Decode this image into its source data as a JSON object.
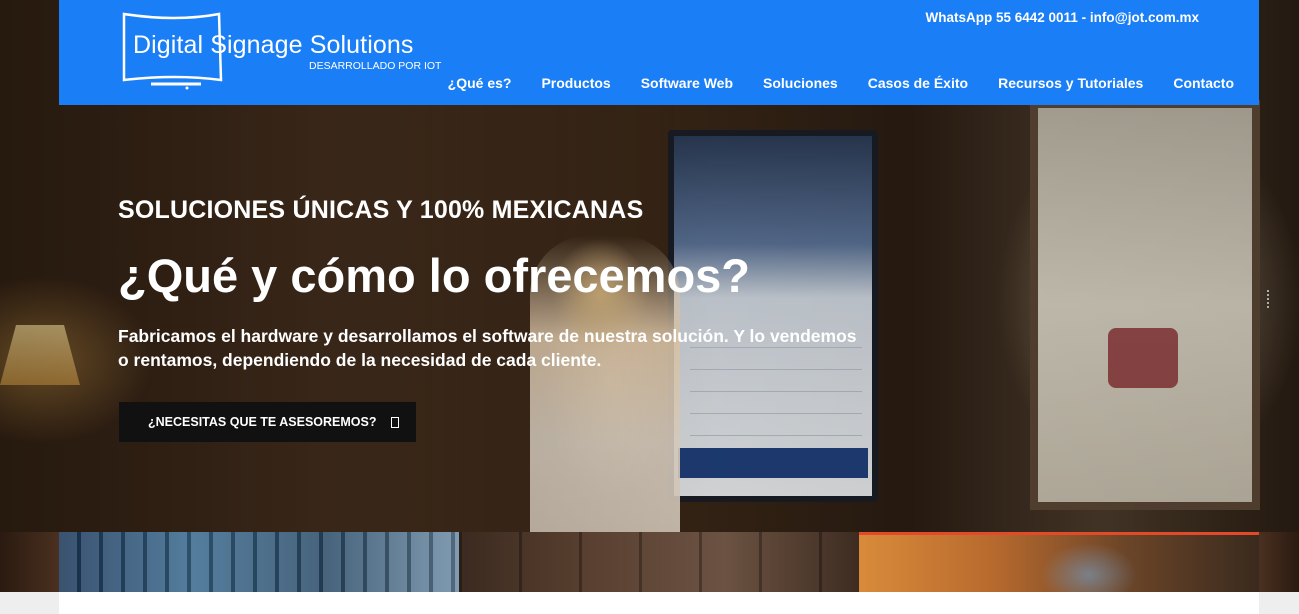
{
  "header": {
    "logo": {
      "title": "Digital Signage Solutions",
      "subtitle": "DESARROLLADO POR IOT"
    },
    "contact": "WhatsApp 55 6442 0011 - info@jot.com.mx",
    "nav": [
      {
        "label": "¿Qué es?"
      },
      {
        "label": "Productos"
      },
      {
        "label": "Software Web"
      },
      {
        "label": "Soluciones"
      },
      {
        "label": "Casos de Éxito"
      },
      {
        "label": "Recursos y Tutoriales"
      },
      {
        "label": "Contacto"
      }
    ]
  },
  "hero": {
    "kicker": "SOLUCIONES ÚNICAS Y 100% MEXICANAS",
    "headline": "¿Qué y cómo lo ofrecemos?",
    "description": "Fabricamos el hardware y desarrollamos el software de nuestra solución. Y lo vendemos o rentamos, dependiendo de la necesidad de cada cliente.",
    "cta_label": "¿NECESITAS QUE TE ASESOREMOS?",
    "cta_icon": "external-link-icon"
  },
  "colors": {
    "header_bg": "#1a7ef7",
    "cta_bg": "#111111",
    "thumb_accent": "#e24a2a"
  }
}
